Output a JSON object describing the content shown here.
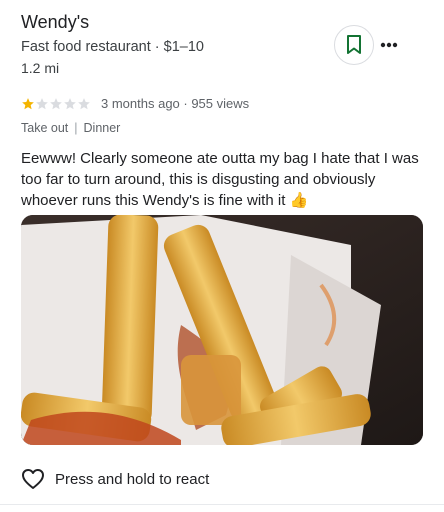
{
  "place": {
    "name": "Wendy's",
    "category_price": "Fast food restaurant · $1–10",
    "distance": "1.2 mi"
  },
  "review": {
    "rating": 1,
    "max_rating": 5,
    "meta": "3 months ago · 955 views",
    "tags": [
      "Take out",
      "Dinner"
    ],
    "text": "Eewww! Clearly someone ate outta my bag I hate that I was too far to turn around, this is disgusting and obviously whoever runs this Wendy's is fine with it 👍",
    "photo_icon": "fries-photo"
  },
  "actions": {
    "react_label": "Press and hold to react",
    "save_icon": "bookmark-icon",
    "more_icon": "more-horiz-icon",
    "react_icon": "heart-outline-icon"
  },
  "colors": {
    "star_filled": "#f4b400",
    "star_empty": "#dadce0",
    "accent": "#1a73e8"
  }
}
